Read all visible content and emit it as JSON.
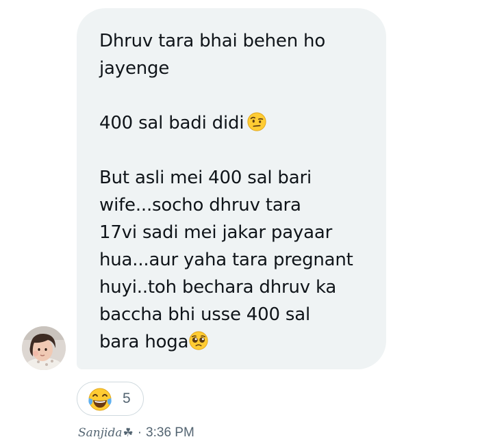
{
  "message": {
    "line_1": "Dhruv tara bhai behen ho",
    "line_2": "jayenge",
    "line_3": "400 sal badi didi",
    "line_3_emoji": "face-with-raised-eyebrow-icon",
    "line_4": "But asli mei 400 sal bari",
    "line_5": "wife...socho dhruv tara",
    "line_6": "17vi sadi mei jakar payaar",
    "line_7": "hua...aur yaha tara pregnant",
    "line_8": "huyi..toh bechara dhruv ka",
    "line_9": "baccha bhi usse 400 sal",
    "line_10": "bara hoga",
    "line_10_emoji": "pleading-face-icon",
    "bubble_color": "#eff3f4",
    "text_color": "#0f1419"
  },
  "reaction": {
    "emoji": "face-with-tears-of-joy-icon",
    "count": "5"
  },
  "meta": {
    "sender_name": "Sanjida",
    "sender_symbol": "☘",
    "separator": "·",
    "time": "3:36 PM",
    "meta_color": "#536471"
  }
}
